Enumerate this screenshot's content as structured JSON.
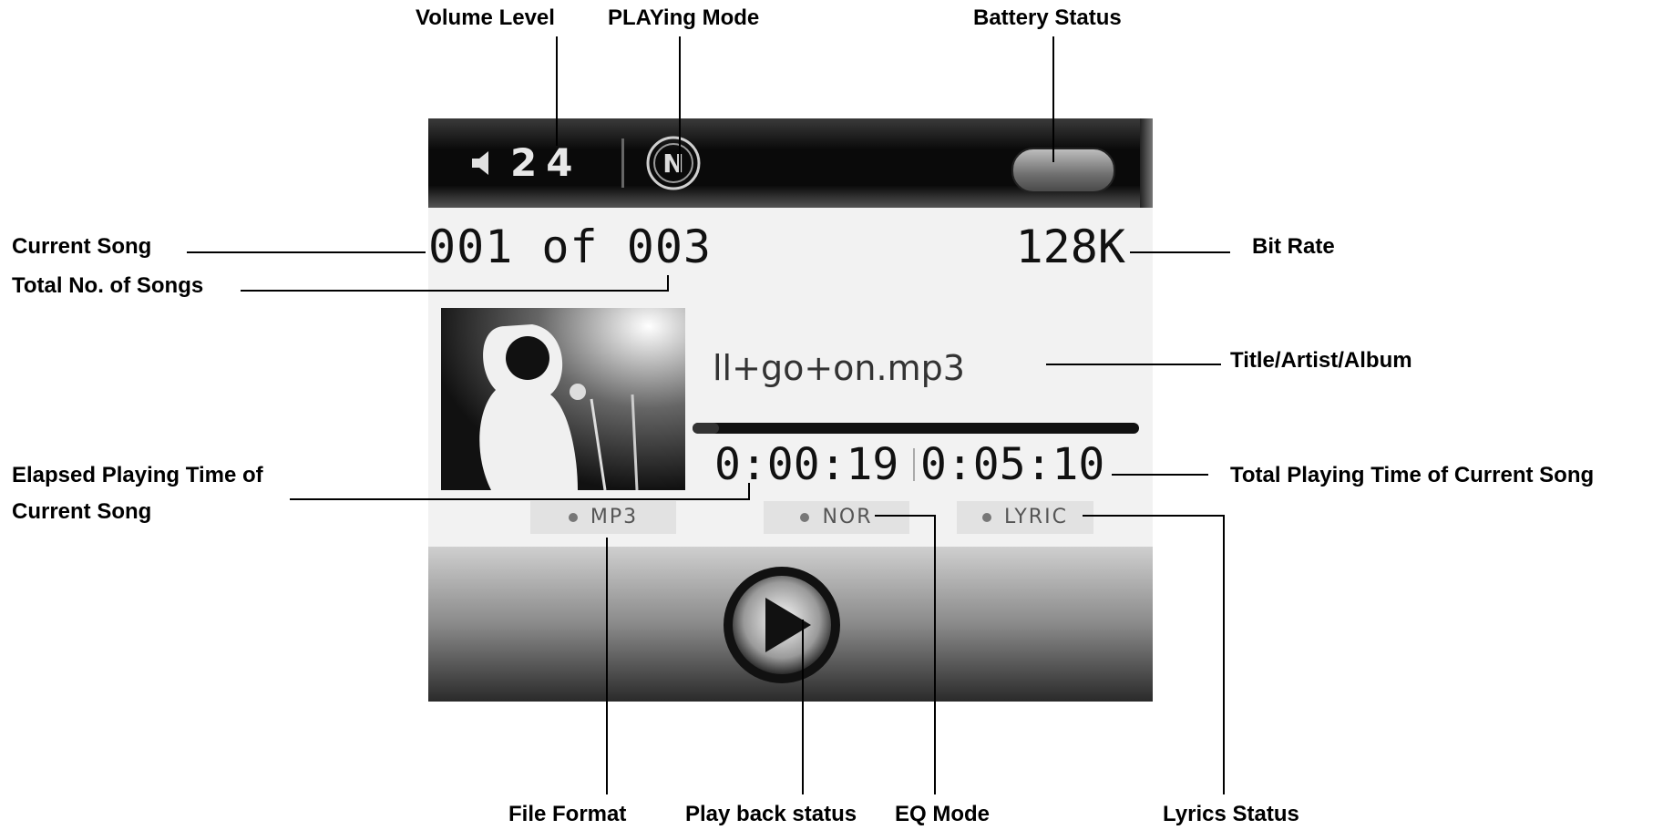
{
  "device_screen": {
    "volume": "24",
    "song_index": "001 of 003",
    "bitrate": "128K",
    "title": "ll+go+on.mp3",
    "elapsed_time": "0:00:19",
    "total_time": "0:05:10",
    "tags": {
      "file_format": "MP3",
      "eq_mode": "NOR",
      "lyrics": "LYRIC"
    },
    "progress_fraction": 0.06,
    "icons": [
      "speaker-icon",
      "playing-mode-icon",
      "battery-icon",
      "album-art",
      "play-icon"
    ]
  },
  "labels": {
    "volume_level": "Volume Level",
    "playing_mode": "PLAYing Mode",
    "battery_status": "Battery Status",
    "current_song": "Current Song",
    "total_songs": "Total No. of Songs",
    "bit_rate": "Bit Rate",
    "title_artist_album": "Title/Artist/Album",
    "elapsed_time_line1": "Elapsed Playing Time of",
    "elapsed_time_line2": "Current Song",
    "total_time": "Total Playing Time of Current Song",
    "file_format": "File Format",
    "playback_status": "Play back status",
    "eq_mode": "EQ Mode",
    "lyrics_status": "Lyrics Status"
  }
}
